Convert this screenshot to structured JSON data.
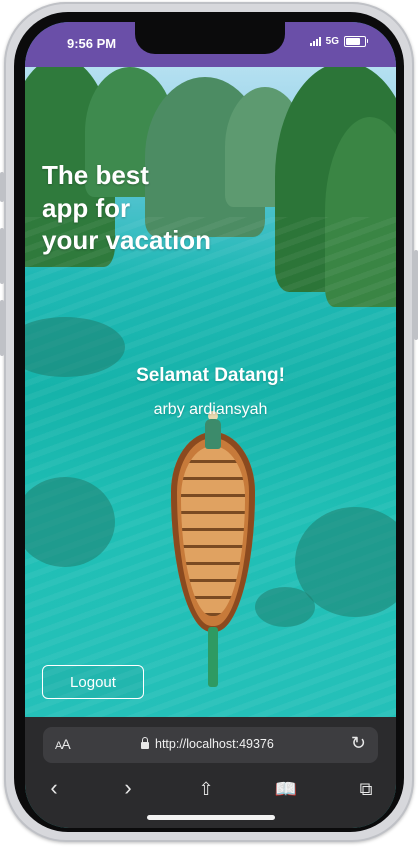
{
  "status_bar": {
    "time": "9:56 PM",
    "network": "5G",
    "battery_level": 0.9
  },
  "hero": {
    "title_lines": [
      "The best",
      "app for",
      "your vacation"
    ]
  },
  "welcome": {
    "greeting": "Selamat Datang!",
    "username": "arby ardiansyah"
  },
  "actions": {
    "logout_label": "Logout"
  },
  "browser": {
    "text_size_label_big": "A",
    "text_size_label_small": "A",
    "url": "http://localhost:49376"
  },
  "colors": {
    "status_bar_bg": "#6a4fa8",
    "browser_bg": "#2b2b2d"
  },
  "icons": [
    "lock-icon",
    "reload-icon",
    "back-icon",
    "forward-icon",
    "share-icon",
    "bookmarks-icon",
    "tabs-icon"
  ]
}
